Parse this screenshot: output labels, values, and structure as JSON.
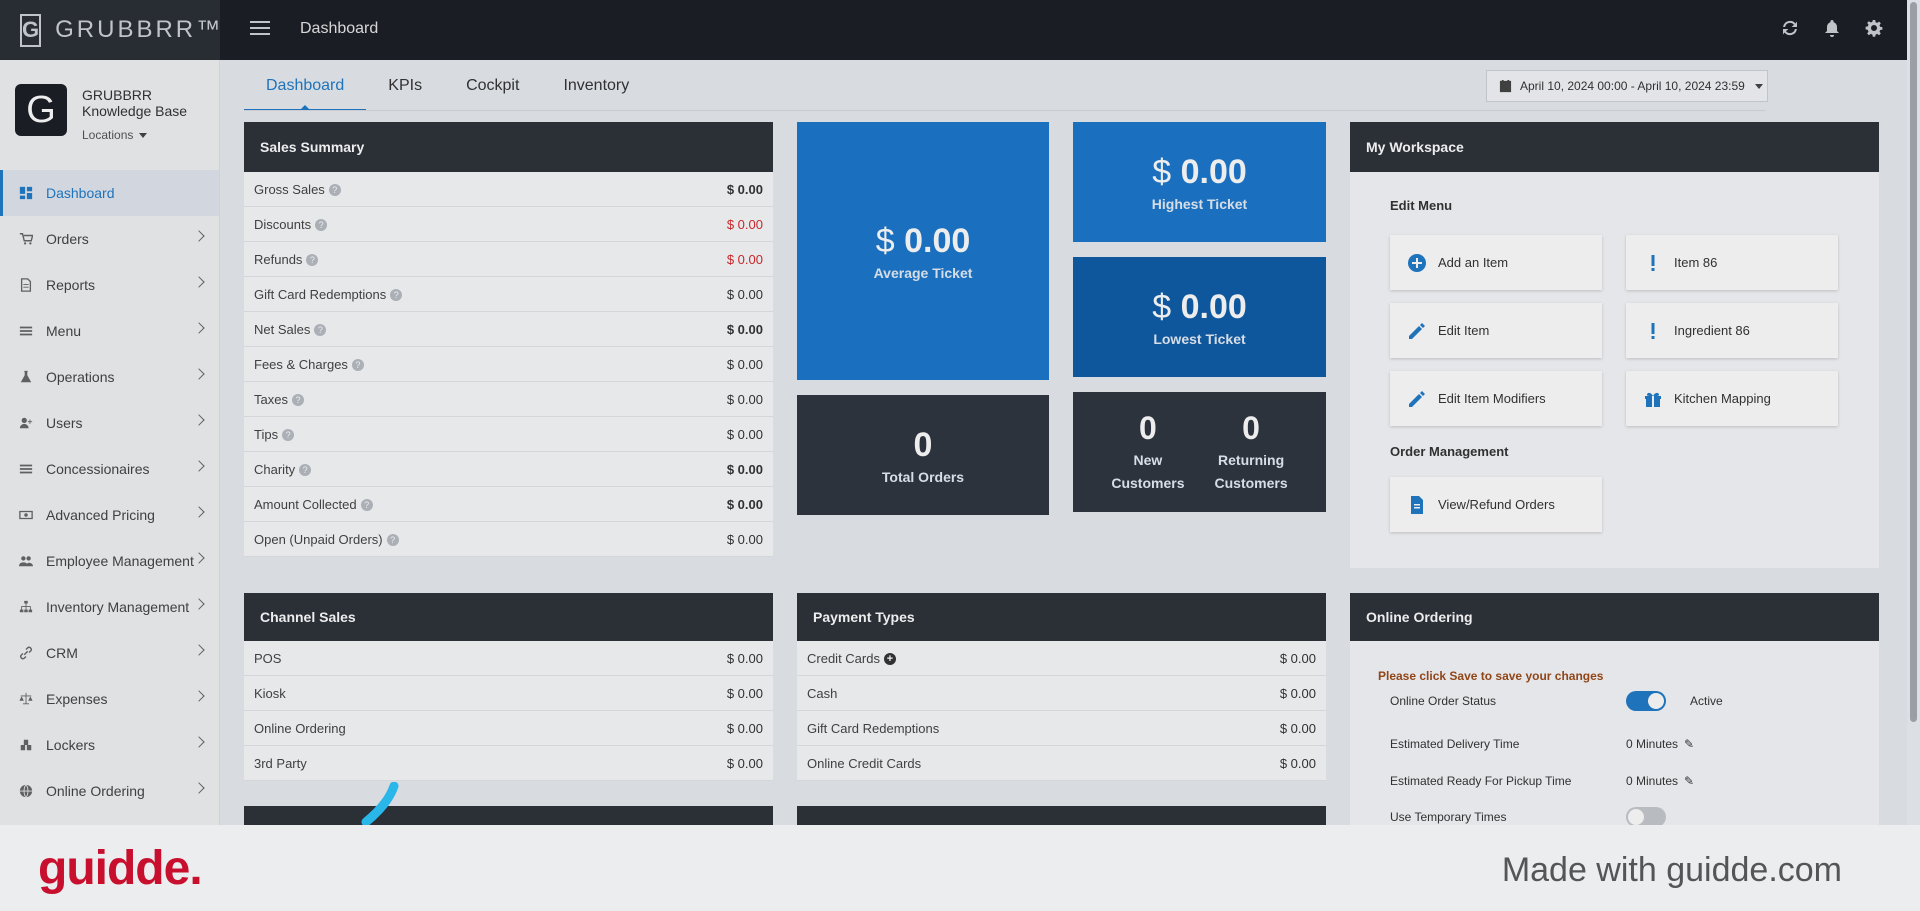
{
  "brand": {
    "logo_letter": "G",
    "name": "GRUBBRR™"
  },
  "topbar": {
    "title": "Dashboard",
    "icons": [
      "refresh-icon",
      "bell-icon",
      "gear-icon"
    ]
  },
  "profile": {
    "avatar_letter": "G",
    "org_line1": "GRUBBRR",
    "org_line2": "Knowledge Base",
    "locations": "Locations"
  },
  "sidebar": {
    "items": [
      {
        "label": "Dashboard",
        "icon": "dashboard-icon",
        "active": true
      },
      {
        "label": "Orders",
        "icon": "cart-icon"
      },
      {
        "label": "Reports",
        "icon": "report-icon"
      },
      {
        "label": "Menu",
        "icon": "menu-icon"
      },
      {
        "label": "Operations",
        "icon": "flask-icon"
      },
      {
        "label": "Users",
        "icon": "user-plus-icon"
      },
      {
        "label": "Concessionaires",
        "icon": "list-icon"
      },
      {
        "label": "Advanced Pricing",
        "icon": "money-icon"
      },
      {
        "label": "Employee Management",
        "icon": "users-icon"
      },
      {
        "label": "Inventory Management",
        "icon": "sitemap-icon"
      },
      {
        "label": "CRM",
        "icon": "link-icon"
      },
      {
        "label": "Expenses",
        "icon": "scale-icon"
      },
      {
        "label": "Lockers",
        "icon": "cubes-icon"
      },
      {
        "label": "Online Ordering",
        "icon": "globe-icon"
      }
    ]
  },
  "tabs": [
    {
      "label": "Dashboard",
      "active": true
    },
    {
      "label": "KPIs"
    },
    {
      "label": "Cockpit"
    },
    {
      "label": "Inventory"
    }
  ],
  "daterange": {
    "value": "April 10, 2024 00:00 - April 10, 2024 23:59"
  },
  "sales_summary": {
    "title": "Sales Summary",
    "rows": [
      {
        "label": "Gross Sales",
        "value": "$ 0.00",
        "style": "bold"
      },
      {
        "label": "Discounts",
        "value": "$ 0.00",
        "style": "neg"
      },
      {
        "label": "Refunds",
        "value": "$ 0.00",
        "style": "neg"
      },
      {
        "label": "Gift Card Redemptions",
        "value": "$ 0.00",
        "style": ""
      },
      {
        "label": "Net Sales",
        "value": "$ 0.00",
        "style": "bold"
      },
      {
        "label": "Fees & Charges",
        "value": "$ 0.00",
        "style": ""
      },
      {
        "label": "Taxes",
        "value": "$ 0.00",
        "style": ""
      },
      {
        "label": "Tips",
        "value": "$ 0.00",
        "style": ""
      },
      {
        "label": "Charity",
        "value": "$ 0.00",
        "style": "bold"
      },
      {
        "label": "Amount Collected",
        "value": "$ 0.00",
        "style": "bold"
      },
      {
        "label": "Open (Unpaid Orders)",
        "value": "$ 0.00",
        "style": ""
      }
    ]
  },
  "tiles": {
    "average": {
      "currency": "$",
      "value": "0.00",
      "label": "Average Ticket"
    },
    "highest": {
      "currency": "$",
      "value": "0.00",
      "label": "Highest Ticket"
    },
    "lowest": {
      "currency": "$",
      "value": "0.00",
      "label": "Lowest Ticket"
    },
    "total_orders": {
      "value": "0",
      "label": "Total Orders"
    },
    "new_customers": {
      "value": "0",
      "label_line1": "New",
      "label_line2": "Customers"
    },
    "returning_customers": {
      "value": "0",
      "label_line1": "Returning",
      "label_line2": "Customers"
    }
  },
  "workspace": {
    "title": "My Workspace",
    "edit_menu_heading": "Edit Menu",
    "order_mgmt_heading": "Order Management",
    "buttons": [
      {
        "label": "Add an Item",
        "icon": "plus-circle-icon"
      },
      {
        "label": "Item 86",
        "icon": "exclamation-icon"
      },
      {
        "label": "Edit Item",
        "icon": "pencil-icon"
      },
      {
        "label": "Ingredient 86",
        "icon": "exclamation-icon"
      },
      {
        "label": "Edit Item Modifiers",
        "icon": "pencil-icon"
      },
      {
        "label": "Kitchen Mapping",
        "icon": "gift-icon"
      },
      {
        "label": "View/Refund Orders",
        "icon": "document-icon"
      }
    ]
  },
  "channel_sales": {
    "title": "Channel Sales",
    "rows": [
      {
        "label": "POS",
        "value": "$ 0.00"
      },
      {
        "label": "Kiosk",
        "value": "$ 0.00"
      },
      {
        "label": "Online Ordering",
        "value": "$ 0.00"
      },
      {
        "label": "3rd Party",
        "value": "$ 0.00"
      }
    ]
  },
  "payment_types": {
    "title": "Payment Types",
    "rows": [
      {
        "label": "Credit Cards",
        "value": "$ 0.00",
        "plus": true
      },
      {
        "label": "Cash",
        "value": "$ 0.00"
      },
      {
        "label": "Gift Card Redemptions",
        "value": "$ 0.00"
      },
      {
        "label": "Online Credit Cards",
        "value": "$ 0.00"
      }
    ]
  },
  "online_ordering": {
    "title": "Online Ordering",
    "warning": "Please click Save to save your changes",
    "status_label": "Online Order Status",
    "status_value": "Active",
    "status_on": true,
    "delivery_label": "Estimated Delivery Time",
    "delivery_value": "0 Minutes",
    "pickup_label": "Estimated Ready For Pickup Time",
    "pickup_value": "0 Minutes",
    "temp_label": "Use Temporary Times",
    "temp_on": false
  },
  "footer": {
    "logo": "guidde.",
    "made_with": "Made with guidde.com"
  },
  "colors": {
    "accent": "#1f7bc8",
    "tile_blue": "#1b78cc",
    "tile_navy": "#0e5da8",
    "tile_dark": "#2f363f",
    "negative": "#d9282b",
    "footer_logo": "#c8102e"
  }
}
